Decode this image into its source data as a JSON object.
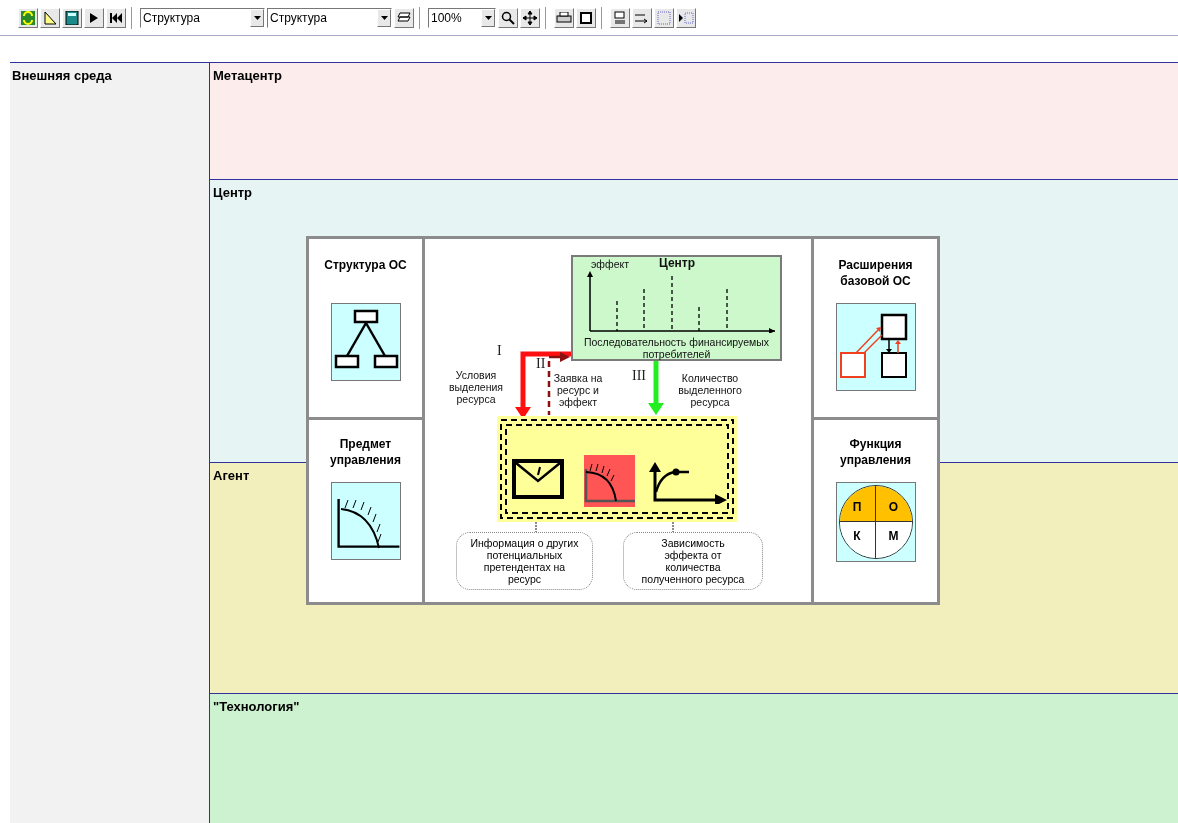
{
  "toolbar": {
    "dropdowns": [
      {
        "value": "Структура"
      },
      {
        "value": "Структура"
      }
    ],
    "zoom": "100%"
  },
  "outer_lane": {
    "title": "Внешняя среда"
  },
  "lanes": [
    {
      "title": "Метацентр",
      "color": "#fcecec"
    },
    {
      "title": "Центр",
      "color": "#e6f4f4"
    },
    {
      "title": "Агент",
      "color": "#f2efbd"
    },
    {
      "title": "\"Технология\"",
      "color": "#ccf2d0"
    }
  ],
  "diagram": {
    "left_panels": [
      {
        "title": "Структура ОС",
        "kind": "tree"
      },
      {
        "title": "Предмет управления",
        "kind": "curve"
      }
    ],
    "right_panels": [
      {
        "title": "Расширения базовой ОС",
        "kind": "extension"
      },
      {
        "title": "Функция управления",
        "kind": "circle",
        "quadrants": [
          "П",
          "О",
          "К",
          "М"
        ]
      }
    ],
    "center": {
      "chart_title": "Центр",
      "y_label": "эффект",
      "x_label": "Последовательность финансируемых потребителей",
      "flows": [
        {
          "numeral": "I",
          "label": "Условия выделения ресурса"
        },
        {
          "numeral": "II",
          "label": "Заявка на ресурс и эффект"
        },
        {
          "numeral": "III",
          "label": "Количество выделенного ресурса"
        }
      ],
      "callouts": [
        "Информация о других потенциальных претендентах на ресурс",
        "Зависимость эффекта от количества полученного ресурса"
      ]
    }
  }
}
